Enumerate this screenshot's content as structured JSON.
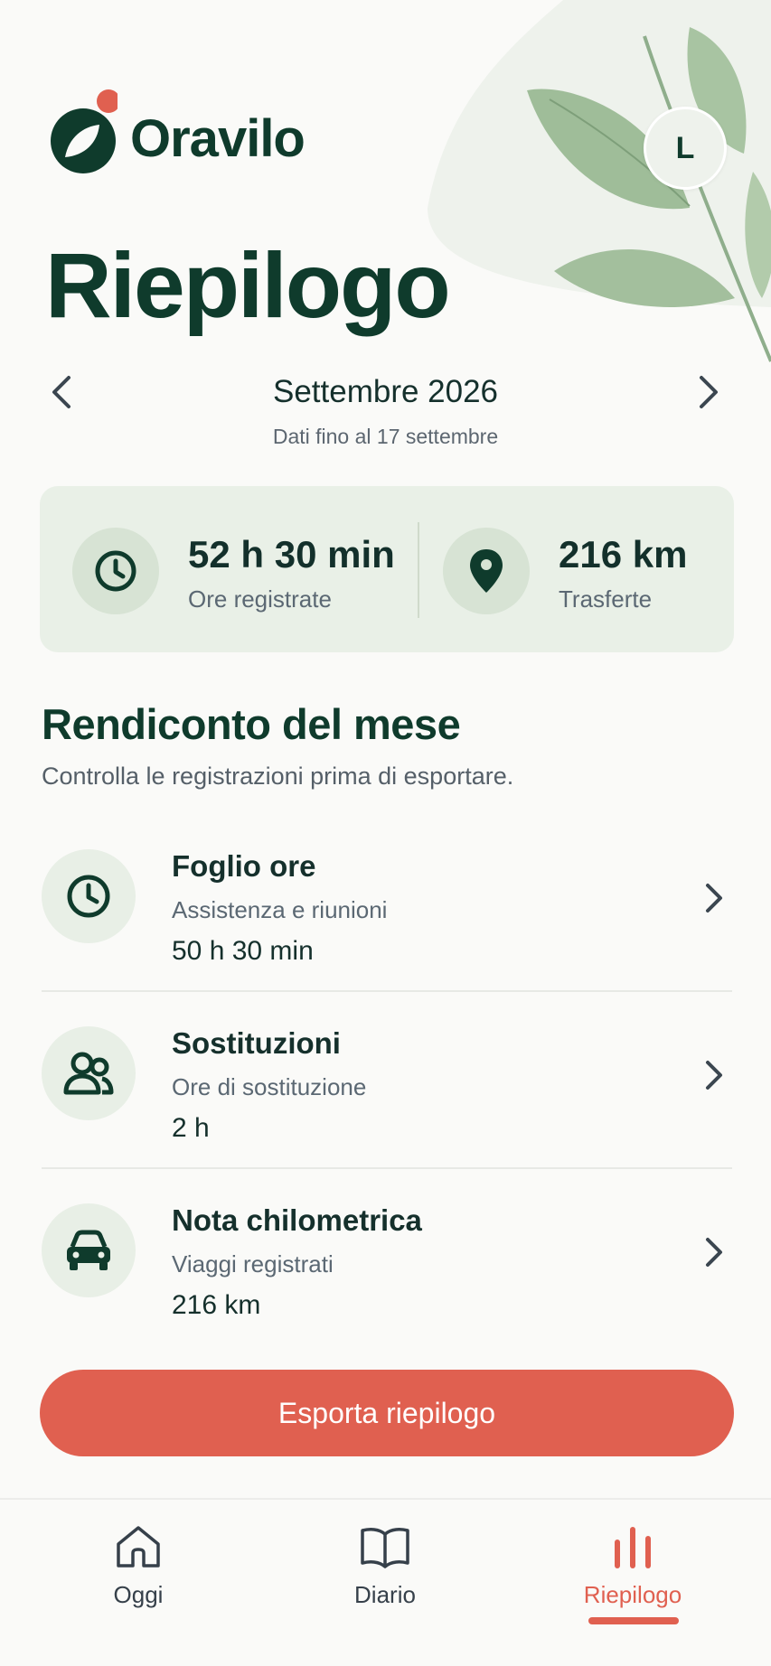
{
  "app": {
    "brand": "Oravilo",
    "avatar_initial": "L"
  },
  "page": {
    "title": "Riepilogo"
  },
  "month_nav": {
    "label": "Settembre 2026",
    "subtitle": "Dati fino al 17 settembre"
  },
  "stats": {
    "hours": {
      "value": "52 h 30 min",
      "label": "Ore registrate",
      "icon": "clock-icon"
    },
    "distance": {
      "value": "216 km",
      "label": "Trasferte",
      "icon": "location-pin-icon"
    }
  },
  "section": {
    "title": "Rendiconto del mese",
    "subtitle": "Controlla le registrazioni prima di esportare."
  },
  "items": [
    {
      "title": "Foglio ore",
      "subtitle": "Assistenza e riunioni",
      "value": "50 h 30 min",
      "icon": "clock-icon"
    },
    {
      "title": "Sostituzioni",
      "subtitle": "Ore di sostituzione",
      "value": "2 h",
      "icon": "people-icon"
    },
    {
      "title": "Nota chilometrica",
      "subtitle": "Viaggi registrati",
      "value": "216 km",
      "icon": "car-icon"
    }
  ],
  "export_label": "Esporta riepilogo",
  "tabs": [
    {
      "label": "Oggi",
      "icon": "home-icon",
      "active": false
    },
    {
      "label": "Diario",
      "icon": "book-icon",
      "active": false
    },
    {
      "label": "Riepilogo",
      "icon": "bar-chart-icon",
      "active": true
    }
  ],
  "colors": {
    "brand_green": "#0f3b2c",
    "accent": "#e06050",
    "card_bg": "#e9f0e7"
  }
}
